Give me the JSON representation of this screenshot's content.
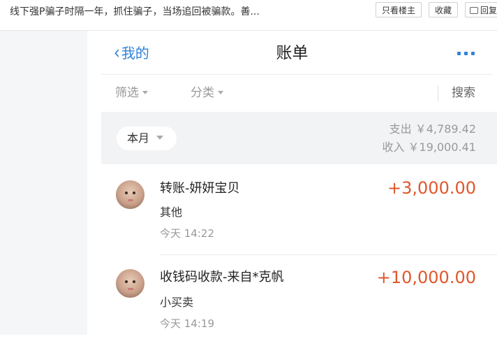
{
  "forum": {
    "post_title": "线下强P骗子时隔一年，抓住骗子，当场追回被骗款。善...",
    "only_op_label": "只看楼主",
    "favorite_label": "收藏",
    "reply_label": "回复"
  },
  "nav": {
    "back_label": "我的",
    "title": "账单"
  },
  "filters": {
    "filter_label": "筛选",
    "category_label": "分类",
    "search_label": "搜索"
  },
  "month": {
    "label": "本月",
    "expense_text": "支出 ￥4,789.42",
    "income_text": "收入 ￥19,000.41"
  },
  "transactions": [
    {
      "title": "转账-妍妍宝贝",
      "category": "其他",
      "time": "今天  14:22",
      "amount": "+3,000.00"
    },
    {
      "title": "收钱码收款-来自*克帆",
      "category": "小买卖",
      "time": "今天  14:19",
      "amount": "+10,000.00"
    }
  ],
  "colors": {
    "accent": "#2f82d8",
    "income_amount": "#e0572b",
    "section_bg": "#f2f3f5"
  }
}
